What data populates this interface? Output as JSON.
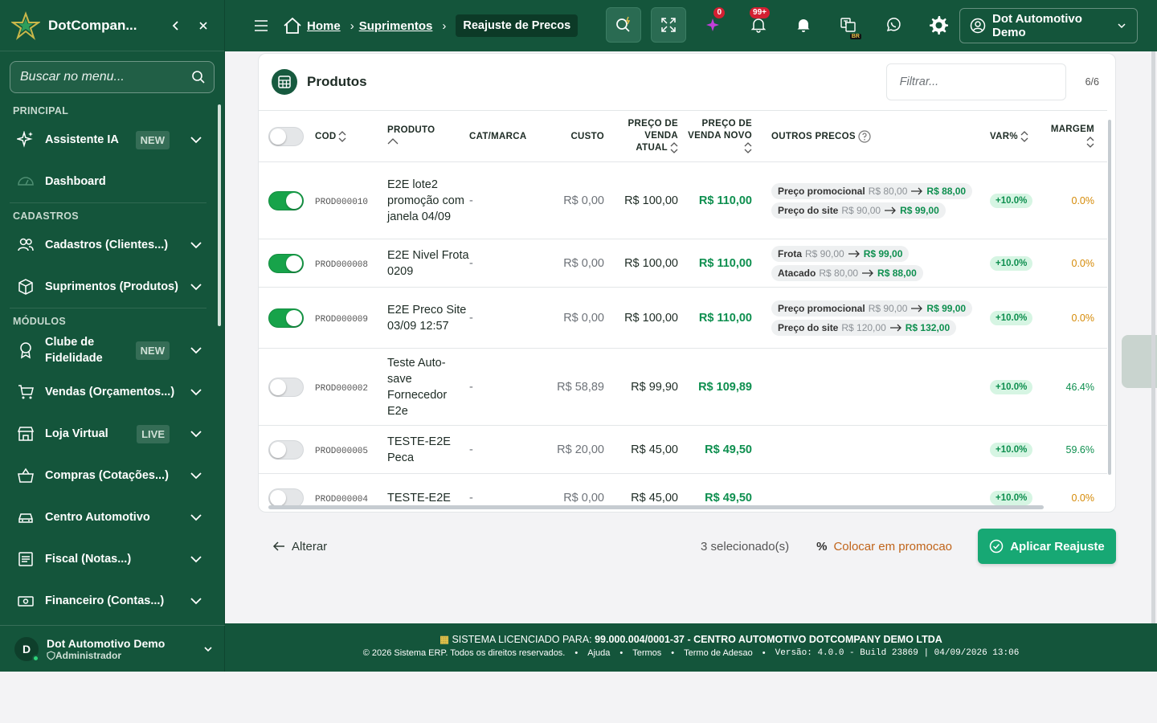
{
  "app": {
    "brand": "DotCompan...",
    "search_placeholder": "Buscar no menu..."
  },
  "sidebar": {
    "sections": [
      {
        "title": "PRINCIPAL",
        "items": [
          {
            "label": "Assistente IA",
            "badge": "NEW",
            "icon": "sparkle-icon"
          },
          {
            "label": "Dashboard",
            "badge": "",
            "icon": "dashboard-icon"
          }
        ]
      },
      {
        "title": "CADASTROS",
        "items": [
          {
            "label": "Cadastros (Clientes...)",
            "badge": "",
            "icon": "users-icon"
          },
          {
            "label": "Suprimentos (Produtos)",
            "badge": "",
            "icon": "box-icon"
          }
        ]
      },
      {
        "title": "MÓDULOS",
        "items": [
          {
            "label": "Clube de Fidelidade",
            "badge": "NEW",
            "icon": "award-icon"
          },
          {
            "label": "Vendas (Orçamentos...)",
            "badge": "",
            "icon": "cart-icon"
          },
          {
            "label": "Loja Virtual",
            "badge": "LIVE",
            "icon": "store-icon"
          },
          {
            "label": "Compras (Cotações...)",
            "badge": "",
            "icon": "basket-icon"
          },
          {
            "label": "Centro Automotivo",
            "badge": "",
            "icon": "car-icon"
          },
          {
            "label": "Fiscal (Notas...)",
            "badge": "",
            "icon": "receipt-icon"
          },
          {
            "label": "Financeiro (Contas...)",
            "badge": "",
            "icon": "money-icon"
          }
        ]
      }
    ],
    "user": {
      "initial": "D",
      "name": "Dot Automotivo Demo",
      "role": "Administrador"
    }
  },
  "topbar": {
    "crumbs": [
      "Home",
      "Suprimentos"
    ],
    "current": "Reajuste de Precos",
    "ai_badge": "0",
    "notif_badge": "99+",
    "lang_badge": "BR",
    "user": "Dot Automotivo Demo"
  },
  "products": {
    "title": "Produtos",
    "filter_placeholder": "Filtrar...",
    "count": "6/6",
    "columns": {
      "cod": "COD",
      "produto": "PRODUTO",
      "cat": "CAT/MARCA",
      "custo": "CUSTO",
      "atual": "PREÇO DE VENDA ATUAL",
      "novo": "PREÇO DE VENDA NOVO",
      "outros": "OUTROS PRECOS",
      "var": "VAR%",
      "margem": "MARGEM"
    },
    "rows": [
      {
        "selected": true,
        "cod": "PROD000010",
        "produto": "E2E lote2 promoção com janela 04/09",
        "cat": "-",
        "custo": "R$ 0,00",
        "atual": "R$ 100,00",
        "novo": "R$ 110,00",
        "outros": [
          {
            "label": "Preço promocional",
            "old": "R$ 80,00",
            "new": "R$ 88,00"
          },
          {
            "label": "Preço do site",
            "old": "R$ 90,00",
            "new": "R$ 99,00"
          }
        ],
        "var": "+10.0%",
        "margem": "0.0%",
        "margem_tone": "orange"
      },
      {
        "selected": true,
        "cod": "PROD000008",
        "produto": "E2E Nivel Frota 0209",
        "cat": "-",
        "custo": "R$ 0,00",
        "atual": "R$ 100,00",
        "novo": "R$ 110,00",
        "outros": [
          {
            "label": "Frota",
            "old": "R$ 90,00",
            "new": "R$ 99,00"
          },
          {
            "label": "Atacado",
            "old": "R$ 80,00",
            "new": "R$ 88,00"
          }
        ],
        "var": "+10.0%",
        "margem": "0.0%",
        "margem_tone": "orange"
      },
      {
        "selected": true,
        "cod": "PROD000009",
        "produto": "E2E Preco Site 03/09 12:57",
        "cat": "-",
        "custo": "R$ 0,00",
        "atual": "R$ 100,00",
        "novo": "R$ 110,00",
        "outros": [
          {
            "label": "Preço promocional",
            "old": "R$ 90,00",
            "new": "R$ 99,00"
          },
          {
            "label": "Preço do site",
            "old": "R$ 120,00",
            "new": "R$ 132,00"
          }
        ],
        "var": "+10.0%",
        "margem": "0.0%",
        "margem_tone": "orange"
      },
      {
        "selected": false,
        "cod": "PROD000002",
        "produto": "Teste Auto-save Fornecedor E2e",
        "cat": "-",
        "custo": "R$ 58,89",
        "atual": "R$ 99,90",
        "novo": "R$ 109,89",
        "outros": [],
        "var": "+10.0%",
        "margem": "46.4%",
        "margem_tone": "green"
      },
      {
        "selected": false,
        "cod": "PROD000005",
        "produto": "TESTE-E2E Peca",
        "cat": "-",
        "custo": "R$ 20,00",
        "atual": "R$ 45,00",
        "novo": "R$ 49,50",
        "outros": [],
        "var": "+10.0%",
        "margem": "59.6%",
        "margem_tone": "green"
      },
      {
        "selected": false,
        "cod": "PROD000004",
        "produto": "TESTE-E2E",
        "cat": "-",
        "custo": "R$ 0,00",
        "atual": "R$ 45,00",
        "novo": "R$ 49,50",
        "outros": [],
        "var": "+10.0%",
        "margem": "0.0%",
        "margem_tone": "orange"
      }
    ]
  },
  "actions": {
    "back": "Alterar",
    "selected": "3 selecionado(s)",
    "promo": "Colocar em promocao",
    "apply": "Aplicar Reajuste"
  },
  "footer": {
    "license_label": "SISTEMA LICENCIADO PARA:",
    "license_value": "99.000.004/0001-37 - CENTRO AUTOMOTIVO DOTCOMPANY DEMO LTDA",
    "copyright": "© 2026 Sistema ERP. Todos os direitos reservados.",
    "links": [
      "Ajuda",
      "Termos",
      "Termo de Adesao"
    ],
    "version": "Versão: 4.0.0 - Build 23869 | 04/09/2026 13:06"
  },
  "colors": {
    "brand": "#14553b",
    "accent": "#17a874",
    "positive": "#0e8f4f",
    "warning": "#d58a06"
  }
}
